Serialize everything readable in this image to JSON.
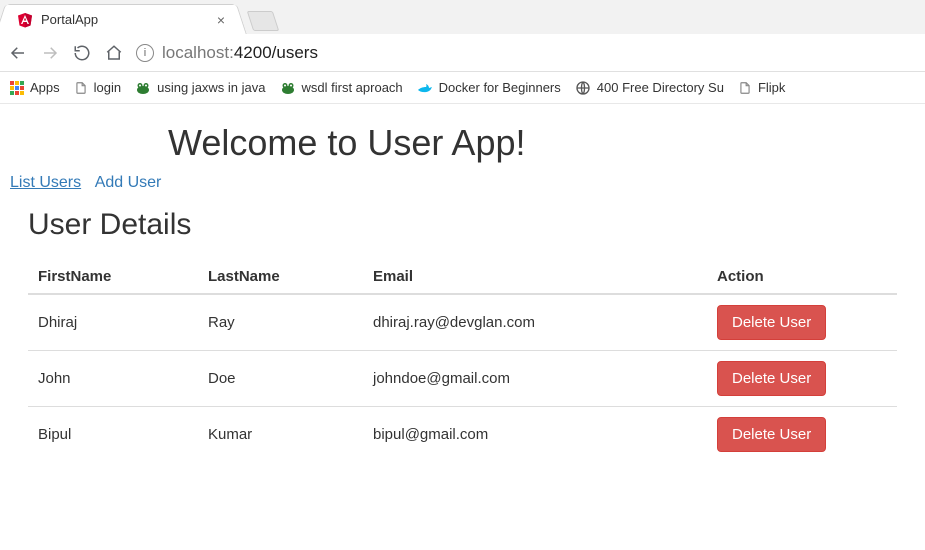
{
  "browser": {
    "tab_title": "PortalApp",
    "url_host_dim": "localhost:",
    "url_port": "4200",
    "url_path": "/users",
    "close_glyph": "×"
  },
  "bookmarks_bar": {
    "apps": "Apps",
    "items": [
      {
        "label": "login",
        "icon": "file"
      },
      {
        "label": "using jaxws in java",
        "icon": "frog"
      },
      {
        "label": "wsdl first aproach",
        "icon": "frog"
      },
      {
        "label": "Docker for Beginners",
        "icon": "whale"
      },
      {
        "label": "400 Free Directory Su",
        "icon": "globe"
      },
      {
        "label": "Flipk",
        "icon": "file"
      }
    ]
  },
  "page": {
    "heading": "Welcome to User App!",
    "nav": {
      "list_users": "List Users",
      "add_user": "Add User"
    },
    "subheading": "User Details",
    "columns": {
      "first": "FirstName",
      "last": "LastName",
      "email": "Email",
      "action": "Action"
    },
    "rows": [
      {
        "first": "Dhiraj",
        "last": "Ray",
        "email": "dhiraj.ray@devglan.com"
      },
      {
        "first": "John",
        "last": "Doe",
        "email": "johndoe@gmail.com"
      },
      {
        "first": "Bipul",
        "last": "Kumar",
        "email": "bipul@gmail.com"
      }
    ],
    "delete_label": "Delete User"
  }
}
